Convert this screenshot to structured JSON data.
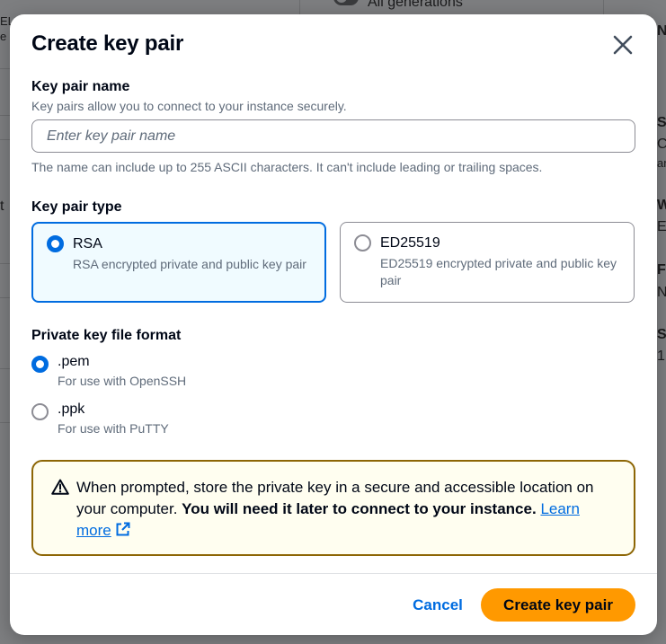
{
  "background": {
    "top_toggle_label": "All generations",
    "left_fragments": [
      "EL",
      "e",
      "t"
    ],
    "right_fragments": [
      "N",
      "S",
      "C",
      "an",
      "W",
      "E",
      "Fi",
      "N",
      "St",
      "1"
    ]
  },
  "modal": {
    "title": "Create key pair",
    "close_icon": "close-icon"
  },
  "key_pair_name": {
    "label": "Key pair name",
    "description": "Key pairs allow you to connect to your instance securely.",
    "value": "",
    "placeholder": "Enter key pair name",
    "constraint": "The name can include up to 255 ASCII characters. It can't include leading or trailing spaces."
  },
  "key_pair_type": {
    "label": "Key pair type",
    "options": [
      {
        "title": "RSA",
        "description": "RSA encrypted private and public key pair",
        "selected": true
      },
      {
        "title": "ED25519",
        "description": "ED25519 encrypted private and public key pair",
        "selected": false
      }
    ]
  },
  "file_format": {
    "label": "Private key file format",
    "options": [
      {
        "title": ".pem",
        "description": "For use with OpenSSH",
        "selected": true
      },
      {
        "title": ".ppk",
        "description": "For use with PuTTY",
        "selected": false
      }
    ]
  },
  "alert": {
    "icon": "warning-icon",
    "text_plain": "When prompted, store the private key in a secure and accessible location on your computer. ",
    "text_bold": "You will need it later to connect to your instance.",
    "link_text": "Learn more",
    "link_icon": "external-link-icon"
  },
  "footer": {
    "cancel_label": "Cancel",
    "create_label": "Create key pair"
  },
  "colors": {
    "accent": "#006ce0",
    "primary_button": "#ff9900",
    "warning_border": "#8d6605",
    "warning_bg": "#fffef0",
    "selected_tile_bg": "#f0fbff"
  }
}
